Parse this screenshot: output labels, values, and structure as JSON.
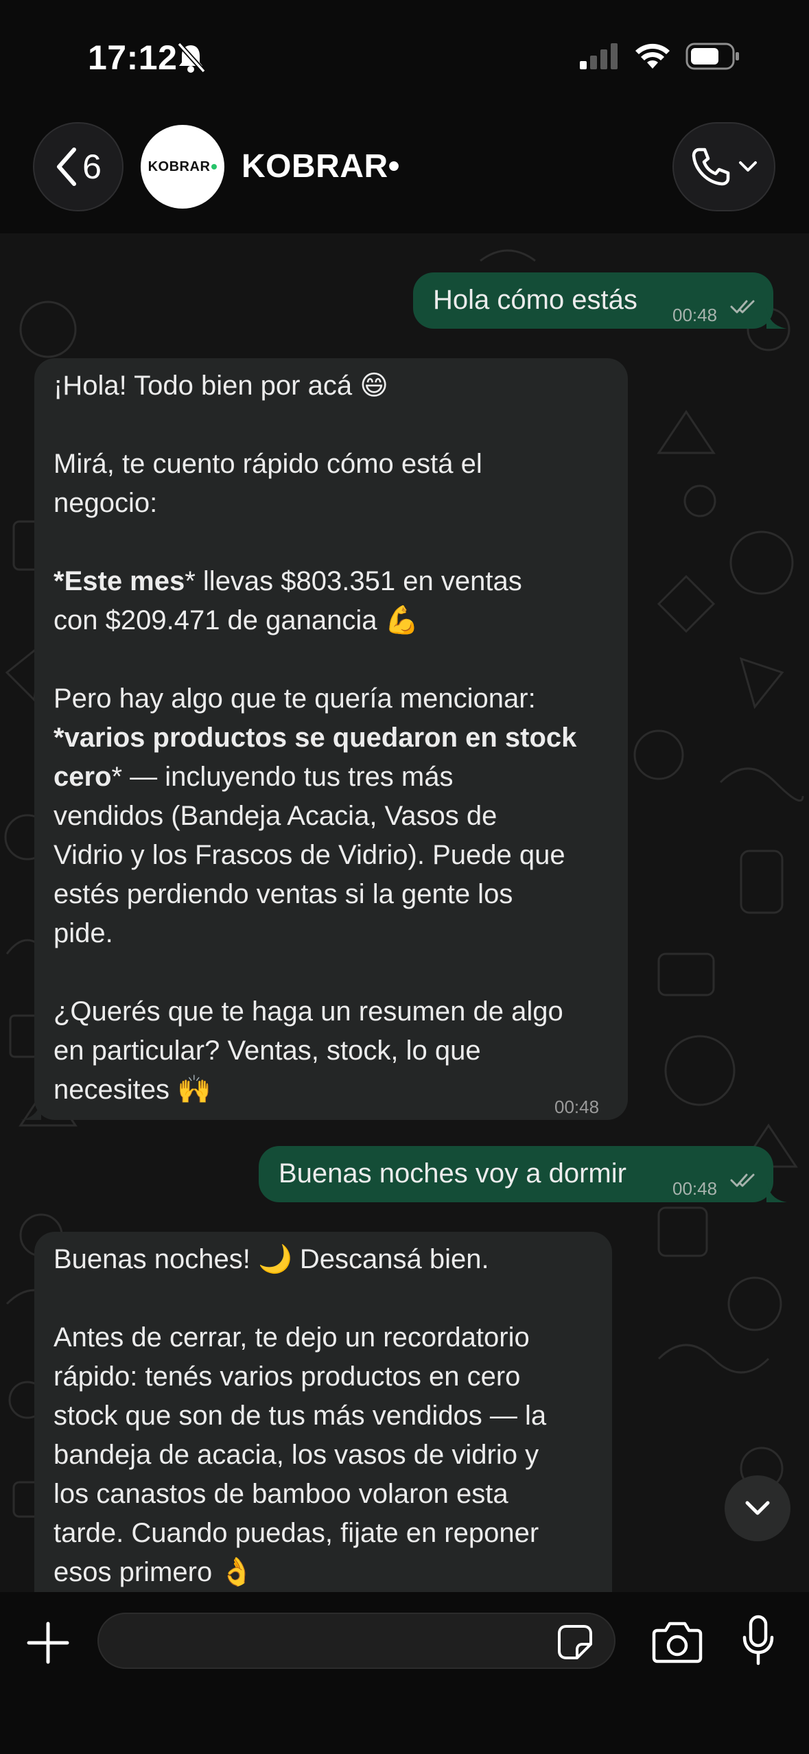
{
  "status": {
    "time": "17:12",
    "icons": [
      "bell-slash-icon",
      "cellular-signal-icon",
      "wifi-icon",
      "battery-icon"
    ]
  },
  "header": {
    "back_count": "6",
    "avatar_text": "KOBRAR",
    "contact_name": "KOBRAR•",
    "call_icon": "phone-icon"
  },
  "messages": [
    {
      "direction": "outgoing",
      "lines": [
        "Hola cómo estás"
      ],
      "time": "00:48",
      "status": "read"
    },
    {
      "direction": "incoming",
      "lines": [
        "¡Hola! Todo bien por acá 😄",
        "",
        "Mirá, te cuento rápido cómo está el",
        "negocio:",
        "",
        "*Este mes* llevas $803.351 en ventas",
        "con $209.471 de ganancia 💪",
        "",
        "Pero hay algo que te quería mencionar:",
        "*varios productos se quedaron en stock",
        "cero* — incluyendo tus tres más",
        "vendidos (Bandeja Acacia, Vasos de",
        "Vidrio y los Frascos de Vidrio). Puede que",
        "estés perdiendo ventas si la gente los",
        "pide.",
        "",
        "¿Querés que te haga un resumen de algo",
        "en particular? Ventas, stock, lo que",
        "necesites 🙌"
      ],
      "time": "00:48"
    },
    {
      "direction": "outgoing",
      "lines": [
        "Buenas noches voy a dormir"
      ],
      "time": "00:48",
      "status": "read"
    },
    {
      "direction": "incoming",
      "lines": [
        "Buenas noches! 🌙 Descansá bien.",
        "",
        "Antes de cerrar, te dejo un recordatorio",
        "rápido: tenés varios productos en cero",
        "stock que son de tus más vendidos — la",
        "bandeja de acacia, los vasos de vidrio y",
        "los canastos de bamboo volaron esta",
        "tarde. Cuando puedas, fijate en reponer",
        "esos primero 👌"
      ],
      "time": ""
    }
  ],
  "composer": {
    "value": "",
    "icons": [
      "plus-icon",
      "sticker-icon",
      "camera-icon",
      "microphone-icon"
    ]
  },
  "colors": {
    "outgoing_bubble": "#144d37",
    "incoming_bubble": "#242626",
    "background": "#0b0b0b"
  }
}
